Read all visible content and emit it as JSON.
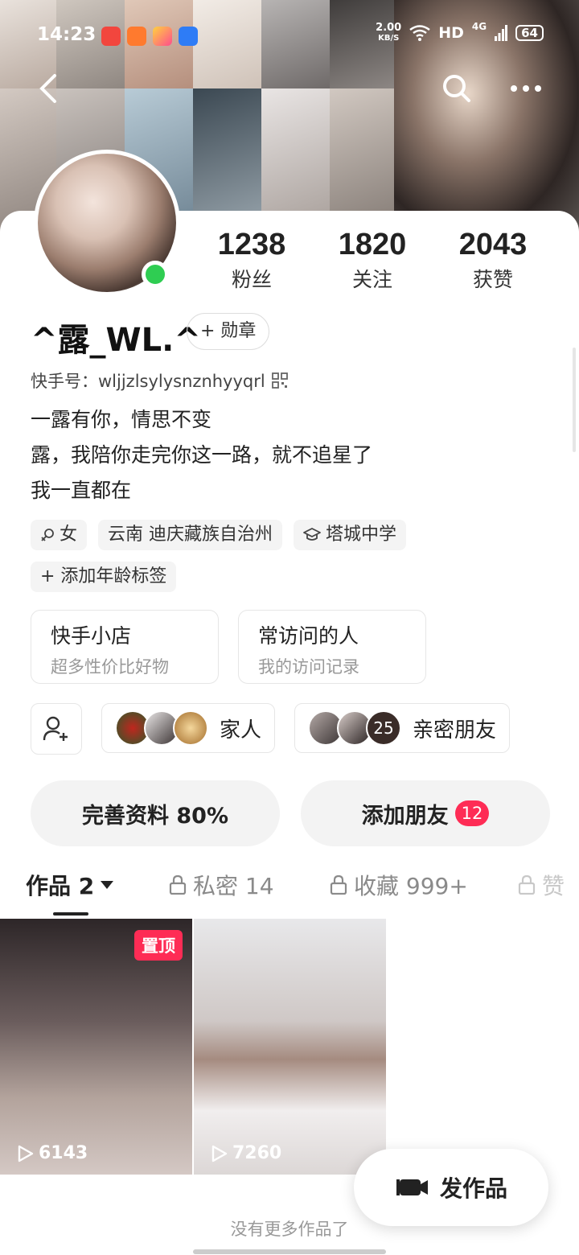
{
  "status_bar": {
    "time": "14:23",
    "net_speed_value": "2.00",
    "net_speed_unit": "KB/S",
    "network_hd": "HD",
    "network_type": "4G",
    "battery": "64"
  },
  "profile": {
    "username": "^露_WL.^",
    "badge_label": "+ 勋章",
    "kuaishou_id": "快手号：wljjzlsylysnznhyyqrl",
    "bio_lines": [
      "一露有你，情思不变",
      "露，我陪你走完你这一路，就不追星了",
      "我一直都在"
    ],
    "online": true
  },
  "stats": [
    {
      "value": "1238",
      "label": "粉丝"
    },
    {
      "value": "1820",
      "label": "关注"
    },
    {
      "value": "2043",
      "label": "获赞"
    }
  ],
  "tags": {
    "gender": "女",
    "location": "云南 迪庆藏族自治州",
    "school": "塔城中学",
    "add_age": "+ 添加年龄标签"
  },
  "shop_cards": [
    {
      "title": "快手小店",
      "subtitle": "超多性价比好物"
    },
    {
      "title": "常访问的人",
      "subtitle": "我的访问记录"
    }
  ],
  "groups": [
    {
      "label": "家人"
    },
    {
      "label": "亲密朋友",
      "count": "25"
    }
  ],
  "actions": {
    "complete_profile": "完善资料 80%",
    "add_friend": "添加朋友",
    "add_friend_badge": "12"
  },
  "tabs": [
    {
      "label": "作品 2",
      "active": true
    },
    {
      "label": "私密 14",
      "locked": true
    },
    {
      "label": "收藏 999+",
      "locked": true
    },
    {
      "label": "赞",
      "locked": true
    }
  ],
  "posts": [
    {
      "plays": "6143",
      "pinned_label": "置顶"
    },
    {
      "plays": "7260"
    }
  ],
  "footer": {
    "no_more": "没有更多作品了",
    "fab_label": "发作品"
  },
  "colors": {
    "accent_red": "#fe2c55",
    "online_green": "#2fcd52"
  }
}
